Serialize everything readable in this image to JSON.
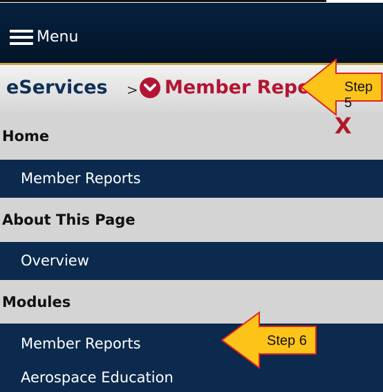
{
  "menu": {
    "label": "Menu",
    "icon": "hamburger-icon"
  },
  "breadcrumb": {
    "root": "eServices",
    "separator": ">",
    "current": "Member Reports",
    "icon": "chevron-down-circle-icon"
  },
  "nav": {
    "close": "X",
    "sections": [
      {
        "title": "Home",
        "items": [
          "Member Reports"
        ]
      },
      {
        "title": "About This Page",
        "items": [
          "Overview"
        ]
      },
      {
        "title": "Modules",
        "items": [
          "Member Reports",
          "Aerospace Education"
        ]
      }
    ]
  },
  "annotations": {
    "step5": "Step 5",
    "step6": "Step 6"
  },
  "colors": {
    "navy": "#0b2a4d",
    "header_gray": "#d4d4d4",
    "accent_red": "#b31535",
    "gold": "#c9a441",
    "callout_fill": "#fcc419",
    "callout_border": "#e02222"
  }
}
